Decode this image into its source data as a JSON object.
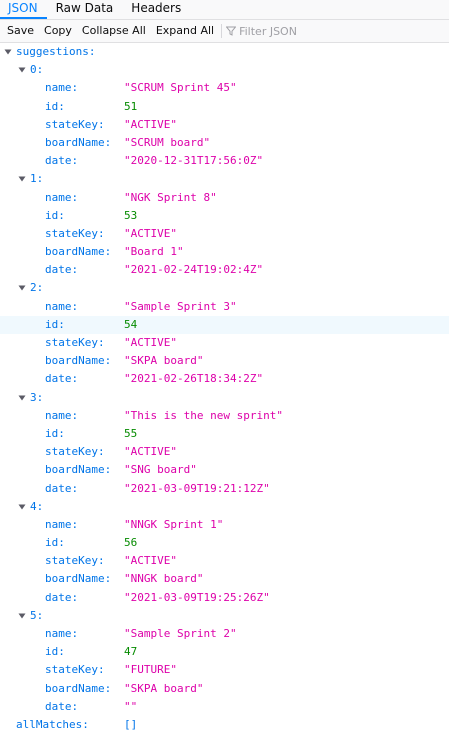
{
  "tabs": [
    {
      "label": "JSON",
      "active": true
    },
    {
      "label": "Raw Data",
      "active": false
    },
    {
      "label": "Headers",
      "active": false
    }
  ],
  "toolbar": {
    "save": "Save",
    "copy": "Copy",
    "collapse_all": "Collapse All",
    "expand_all": "Expand All",
    "filter_placeholder": "Filter JSON"
  },
  "colors": {
    "accent": "#0a84ff",
    "key": "#0074e8",
    "string": "#dd00a9",
    "number": "#058b00",
    "row_highlight": "#f0f9fe"
  },
  "json": {
    "suggestions_key": "suggestions:",
    "suggestions": [
      {
        "index": "0:",
        "name": "\"SCRUM Sprint 45\"",
        "id": "51",
        "stateKey": "\"ACTIVE\"",
        "boardName": "\"SCRUM board\"",
        "date": "\"2020-12-31T17:56:0Z\""
      },
      {
        "index": "1:",
        "name": "\"NGK Sprint 8\"",
        "id": "53",
        "stateKey": "\"ACTIVE\"",
        "boardName": "\"Board 1\"",
        "date": "\"2021-02-24T19:02:4Z\""
      },
      {
        "index": "2:",
        "name": "\"Sample Sprint 3\"",
        "id": "54",
        "stateKey": "\"ACTIVE\"",
        "boardName": "\"SKPA board\"",
        "date": "\"2021-02-26T18:34:2Z\""
      },
      {
        "index": "3:",
        "name": "\"This is the new sprint\"",
        "id": "55",
        "stateKey": "\"ACTIVE\"",
        "boardName": "\"SNG board\"",
        "date": "\"2021-03-09T19:21:12Z\""
      },
      {
        "index": "4:",
        "name": "\"NNGK Sprint 1\"",
        "id": "56",
        "stateKey": "\"ACTIVE\"",
        "boardName": "\"NNGK board\"",
        "date": "\"2021-03-09T19:25:26Z\""
      },
      {
        "index": "5:",
        "name": "\"Sample Sprint 2\"",
        "id": "47",
        "stateKey": "\"FUTURE\"",
        "boardName": "\"SKPA board\"",
        "date": "\"\""
      }
    ],
    "field_labels": {
      "name": "name:",
      "id": "id:",
      "stateKey": "stateKey:",
      "boardName": "boardName:",
      "date": "date:"
    },
    "allMatches_key": "allMatches:",
    "allMatches_value": "[]",
    "highlighted_row": "suggestions.2.id"
  }
}
